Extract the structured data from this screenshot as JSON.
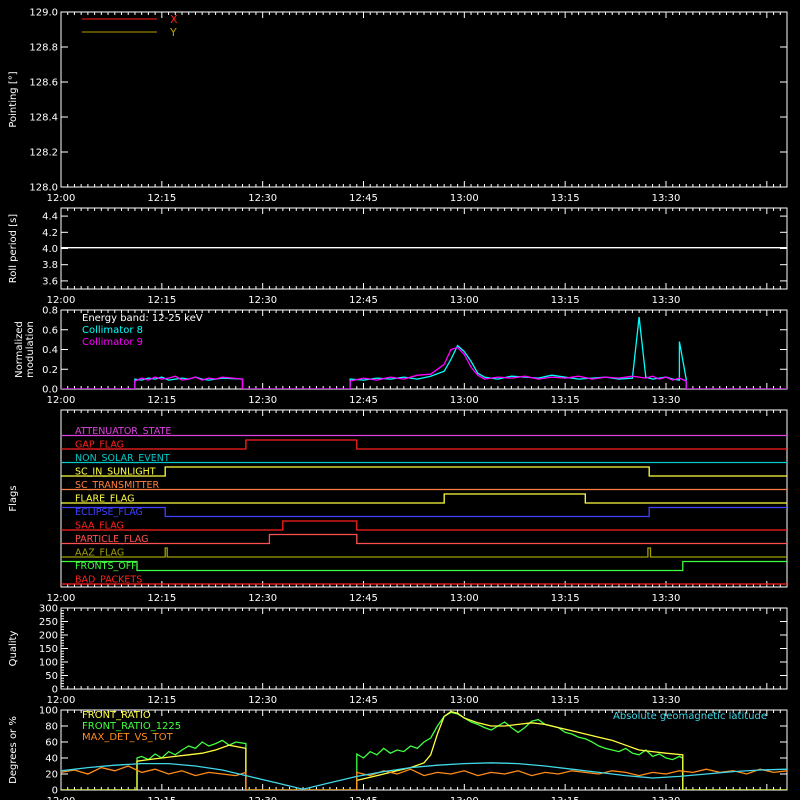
{
  "time_labels": [
    "12:00",
    "12:15",
    "12:30",
    "12:45",
    "13:00",
    "13:15",
    "13:30"
  ],
  "time_range": [
    0,
    108
  ],
  "chart_data": [
    {
      "id": "pointing",
      "type": "line",
      "ylabel": "Pointing [°]",
      "ylim": [
        128.0,
        129.0
      ],
      "yticks": [
        "128.0",
        "128.2",
        "128.4",
        "128.6",
        "128.8",
        "129.0"
      ],
      "legend": [
        "X",
        "Y"
      ],
      "legend_colors": [
        "#ff2020",
        "#b8a000"
      ],
      "series": [
        {
          "name": "X",
          "color": "#ff2020",
          "x": [],
          "y": []
        },
        {
          "name": "Y",
          "color": "#b8a000",
          "x": [],
          "y": []
        }
      ]
    },
    {
      "id": "roll",
      "type": "line",
      "ylabel": "Roll period [s]",
      "ylim": [
        3.5,
        4.5
      ],
      "yticks": [
        "3.6",
        "3.8",
        "4.0",
        "4.2",
        "4.4"
      ],
      "series": [
        {
          "color": "#ffffff",
          "x": [
            0,
            108
          ],
          "y": [
            4.01,
            4.01
          ]
        }
      ]
    },
    {
      "id": "modulation",
      "type": "line",
      "ylabel": [
        "Normalized",
        "modulation"
      ],
      "ylim": [
        0,
        0.8
      ],
      "yticks": [
        "0.0",
        "0.2",
        "0.4",
        "0.6",
        "0.8"
      ],
      "annotation": "Energy band: 12-25 keV",
      "legend": [
        "Collimator 8",
        "Collimator 9"
      ],
      "legend_colors": [
        "#00ffff",
        "#ff00ff"
      ],
      "series": [
        {
          "name": "Collimator 8",
          "color": "#00ffff",
          "x": [
            0,
            11,
            11,
            12,
            13,
            14,
            15,
            16,
            17,
            18,
            19,
            20,
            21,
            22,
            23,
            24,
            27,
            27,
            43,
            43,
            45,
            47,
            49,
            51,
            53,
            55,
            57,
            58,
            59,
            60,
            61,
            62,
            63,
            65,
            67,
            69,
            71,
            73,
            75,
            77,
            79,
            81,
            83,
            85,
            86,
            87,
            88,
            89,
            90,
            91,
            92,
            92,
            93,
            93,
            108
          ],
          "y": [
            0,
            0,
            0.1,
            0.09,
            0.11,
            0.1,
            0.12,
            0.09,
            0.1,
            0.11,
            0.1,
            0.12,
            0.1,
            0.09,
            0.1,
            0.11,
            0.1,
            0,
            0,
            0.1,
            0.09,
            0.11,
            0.1,
            0.12,
            0.1,
            0.13,
            0.18,
            0.3,
            0.44,
            0.38,
            0.28,
            0.16,
            0.12,
            0.1,
            0.13,
            0.12,
            0.11,
            0.14,
            0.12,
            0.1,
            0.11,
            0.12,
            0.1,
            0.11,
            0.73,
            0.12,
            0.1,
            0.11,
            0.12,
            0.1,
            0.09,
            0.48,
            0.1,
            0,
            0
          ]
        },
        {
          "name": "Collimator 9",
          "color": "#ff00ff",
          "x": [
            0,
            11,
            11,
            12,
            13,
            14,
            15,
            16,
            17,
            18,
            19,
            20,
            21,
            22,
            23,
            24,
            27,
            27,
            43,
            43,
            45,
            47,
            49,
            51,
            53,
            55,
            57,
            58,
            59,
            60,
            61,
            62,
            63,
            65,
            67,
            69,
            71,
            73,
            75,
            77,
            79,
            81,
            83,
            85,
            86,
            87,
            88,
            89,
            90,
            91,
            92,
            93,
            93,
            108
          ],
          "y": [
            0,
            0,
            0.08,
            0.11,
            0.09,
            0.12,
            0.1,
            0.11,
            0.13,
            0.09,
            0.1,
            0.12,
            0.09,
            0.11,
            0.1,
            0.12,
            0.1,
            0,
            0,
            0.08,
            0.11,
            0.09,
            0.12,
            0.1,
            0.14,
            0.15,
            0.25,
            0.4,
            0.42,
            0.35,
            0.22,
            0.14,
            0.1,
            0.12,
            0.11,
            0.13,
            0.1,
            0.12,
            0.11,
            0.13,
            0.1,
            0.12,
            0.11,
            0.13,
            0.12,
            0.11,
            0.13,
            0.1,
            0.12,
            0.09,
            0.11,
            0.08,
            0,
            0
          ]
        }
      ]
    },
    {
      "id": "flags",
      "type": "line",
      "ylabel": "Flags",
      "flags": [
        {
          "label": "ATTENUATOR_STATE",
          "color": "#e040e0",
          "changes": [
            [
              0,
              0
            ]
          ]
        },
        {
          "label": "GAP_FLAG",
          "color": "#ff2020",
          "changes": [
            [
              0,
              0
            ],
            [
              27.5,
              1
            ],
            [
              44,
              0
            ]
          ]
        },
        {
          "label": "NON_SOLAR_EVENT",
          "color": "#00c8c8",
          "changes": [
            [
              0,
              0
            ]
          ]
        },
        {
          "label": "SC_IN_SUNLIGHT",
          "color": "#ffff40",
          "changes": [
            [
              0,
              0
            ],
            [
              15.5,
              1
            ],
            [
              87.5,
              0
            ]
          ]
        },
        {
          "label": "SC_TRANSMITTER",
          "color": "#ff8040",
          "changes": [
            [
              0,
              0
            ]
          ]
        },
        {
          "label": "FLARE_FLAG",
          "color": "#ffff40",
          "changes": [
            [
              0,
              0
            ],
            [
              57,
              1
            ],
            [
              78,
              0
            ]
          ]
        },
        {
          "label": "ECLIPSE_FLAG",
          "color": "#4040ff",
          "changes": [
            [
              0,
              1
            ],
            [
              15.5,
              0
            ],
            [
              87.5,
              1
            ]
          ]
        },
        {
          "label": "SAA_FLAG",
          "color": "#ff2020",
          "changes": [
            [
              0,
              0
            ],
            [
              33,
              1
            ],
            [
              44,
              0
            ]
          ]
        },
        {
          "label": "PARTICLE_FLAG",
          "color": "#ff5050",
          "changes": [
            [
              0,
              0
            ],
            [
              31,
              1
            ],
            [
              44,
              0
            ]
          ]
        },
        {
          "label": "AAZ_FLAG",
          "color": "#a0a000",
          "changes": [
            [
              0,
              0
            ],
            [
              15.5,
              1
            ],
            [
              15.8,
              0
            ],
            [
              87.3,
              1
            ],
            [
              87.7,
              0
            ]
          ]
        },
        {
          "label": "FRONTS_OFF",
          "color": "#40ff40",
          "changes": [
            [
              0,
              1
            ],
            [
              11.3,
              0
            ],
            [
              92.5,
              1
            ]
          ]
        },
        {
          "label": "BAD_PACKETS",
          "color": "#ff2020",
          "changes": [
            [
              0,
              0
            ]
          ]
        }
      ]
    },
    {
      "id": "quality",
      "type": "line",
      "ylabel": "Quality",
      "ylim": [
        0,
        300
      ],
      "yticks": [
        "0",
        "50",
        "100",
        "150",
        "200",
        "250",
        "300"
      ],
      "series": []
    },
    {
      "id": "ratio",
      "type": "line",
      "ylabel": "Degrees or %",
      "ylim": [
        0,
        100
      ],
      "yticks": [
        "0",
        "20",
        "40",
        "60",
        "80",
        "100"
      ],
      "legend": [
        "FRONT_RATIO",
        "FRONT_RATIO_1225",
        "MAX_DET_VS_TOT"
      ],
      "legend_colors": [
        "#ffff40",
        "#40ff40",
        "#ff8c1a"
      ],
      "annotation": "Absolute geomagnetic latitude",
      "series": [
        {
          "name": "FRONT_RATIO_1225",
          "color": "#40ff40",
          "x": [
            0,
            11.3,
            11.3,
            12,
            13,
            14,
            15,
            16,
            17,
            18,
            19,
            20,
            21,
            22,
            23,
            24,
            25,
            26,
            27.5,
            27.5,
            44,
            44,
            45,
            46,
            47,
            48,
            49,
            50,
            51,
            52,
            53,
            54,
            55,
            56,
            57,
            58,
            59,
            60,
            61,
            62,
            63,
            64,
            65,
            66,
            67,
            68,
            69,
            70,
            71,
            72,
            73,
            74,
            75,
            76,
            77,
            78,
            79,
            80,
            81,
            82,
            83,
            84,
            85,
            86,
            87,
            88,
            89,
            90,
            91,
            92,
            92.5,
            92.5,
            108
          ],
          "y": [
            0,
            0,
            40,
            42,
            38,
            45,
            40,
            48,
            44,
            50,
            55,
            52,
            60,
            55,
            58,
            62,
            56,
            60,
            58,
            0,
            0,
            45,
            40,
            48,
            44,
            52,
            46,
            50,
            48,
            55,
            52,
            60,
            65,
            80,
            92,
            97,
            95,
            90,
            85,
            82,
            78,
            75,
            80,
            85,
            78,
            72,
            78,
            86,
            88,
            82,
            80,
            78,
            72,
            70,
            66,
            64,
            60,
            55,
            52,
            50,
            48,
            52,
            46,
            44,
            50,
            42,
            45,
            40,
            38,
            42,
            40,
            0,
            0
          ]
        },
        {
          "name": "FRONT_RATIO",
          "color": "#ffff40",
          "x": [
            0,
            11.3,
            11.3,
            13,
            15,
            17,
            19,
            21,
            23,
            25,
            27.5,
            27.5,
            44,
            44,
            46,
            48,
            50,
            52,
            54,
            55,
            56,
            57,
            58,
            59,
            60,
            62,
            64,
            66,
            68,
            70,
            72,
            74,
            76,
            78,
            80,
            82,
            84,
            86,
            88,
            90,
            92.5,
            92.5,
            108
          ],
          "y": [
            0,
            0,
            36,
            38,
            40,
            42,
            44,
            46,
            50,
            56,
            52,
            0,
            0,
            12,
            16,
            20,
            24,
            28,
            34,
            44,
            70,
            92,
            98,
            96,
            90,
            84,
            80,
            80,
            82,
            84,
            82,
            78,
            74,
            70,
            66,
            62,
            56,
            50,
            48,
            46,
            44,
            0,
            0
          ]
        },
        {
          "name": "MAX_DET_VS_TOT",
          "color": "#ff8c1a",
          "x": [
            0,
            2,
            4,
            6,
            8,
            10,
            12,
            14,
            16,
            18,
            20,
            22,
            24,
            26,
            27.5,
            27.5,
            44,
            44,
            46,
            48,
            50,
            52,
            54,
            56,
            58,
            60,
            62,
            64,
            66,
            68,
            70,
            72,
            74,
            76,
            78,
            80,
            82,
            84,
            86,
            88,
            90,
            92,
            94,
            96,
            98,
            100,
            102,
            104,
            106,
            108
          ],
          "y": [
            22,
            25,
            20,
            28,
            24,
            30,
            22,
            26,
            20,
            24,
            18,
            22,
            20,
            18,
            22,
            0,
            0,
            22,
            18,
            24,
            20,
            26,
            18,
            22,
            20,
            24,
            18,
            22,
            20,
            24,
            18,
            22,
            20,
            24,
            22,
            20,
            24,
            22,
            18,
            22,
            20,
            24,
            22,
            26,
            22,
            24,
            20,
            26,
            22,
            24
          ]
        },
        {
          "name": "Absolute geomagnetic latitude",
          "color": "#40d8e8",
          "x": [
            0,
            4,
            8,
            12,
            16,
            20,
            24,
            28,
            32,
            36,
            40,
            44,
            48,
            52,
            56,
            60,
            64,
            68,
            72,
            76,
            80,
            84,
            88,
            92,
            96,
            100,
            104,
            108
          ],
          "y": [
            24,
            28,
            31,
            33,
            33,
            30,
            25,
            17,
            9,
            1,
            9,
            17,
            23,
            28,
            31,
            33,
            34,
            33,
            30,
            26,
            22,
            18,
            15,
            17,
            20,
            23,
            25,
            26
          ]
        }
      ]
    }
  ]
}
